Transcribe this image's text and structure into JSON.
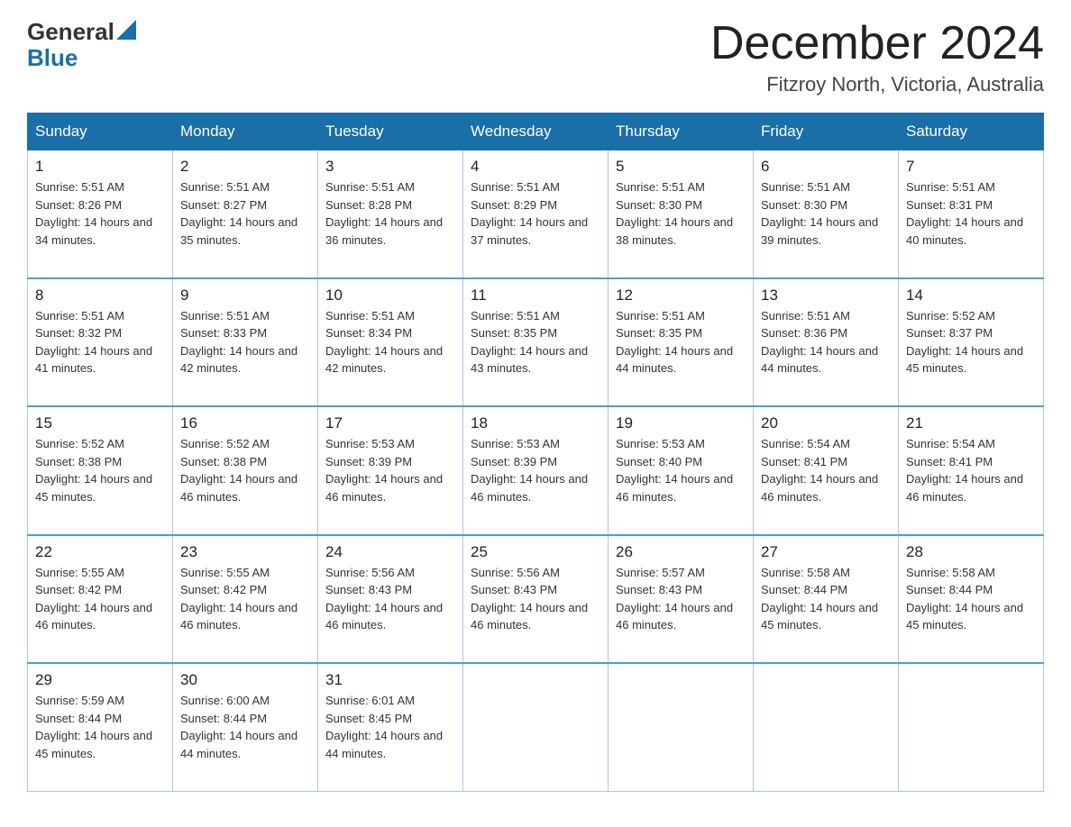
{
  "header": {
    "logo_general": "General",
    "logo_blue": "Blue",
    "month_title": "December 2024",
    "location": "Fitzroy North, Victoria, Australia"
  },
  "calendar": {
    "days_of_week": [
      "Sunday",
      "Monday",
      "Tuesday",
      "Wednesday",
      "Thursday",
      "Friday",
      "Saturday"
    ],
    "weeks": [
      [
        {
          "day": "1",
          "sunrise": "5:51 AM",
          "sunset": "8:26 PM",
          "daylight": "14 hours and 34 minutes."
        },
        {
          "day": "2",
          "sunrise": "5:51 AM",
          "sunset": "8:27 PM",
          "daylight": "14 hours and 35 minutes."
        },
        {
          "day": "3",
          "sunrise": "5:51 AM",
          "sunset": "8:28 PM",
          "daylight": "14 hours and 36 minutes."
        },
        {
          "day": "4",
          "sunrise": "5:51 AM",
          "sunset": "8:29 PM",
          "daylight": "14 hours and 37 minutes."
        },
        {
          "day": "5",
          "sunrise": "5:51 AM",
          "sunset": "8:30 PM",
          "daylight": "14 hours and 38 minutes."
        },
        {
          "day": "6",
          "sunrise": "5:51 AM",
          "sunset": "8:30 PM",
          "daylight": "14 hours and 39 minutes."
        },
        {
          "day": "7",
          "sunrise": "5:51 AM",
          "sunset": "8:31 PM",
          "daylight": "14 hours and 40 minutes."
        }
      ],
      [
        {
          "day": "8",
          "sunrise": "5:51 AM",
          "sunset": "8:32 PM",
          "daylight": "14 hours and 41 minutes."
        },
        {
          "day": "9",
          "sunrise": "5:51 AM",
          "sunset": "8:33 PM",
          "daylight": "14 hours and 42 minutes."
        },
        {
          "day": "10",
          "sunrise": "5:51 AM",
          "sunset": "8:34 PM",
          "daylight": "14 hours and 42 minutes."
        },
        {
          "day": "11",
          "sunrise": "5:51 AM",
          "sunset": "8:35 PM",
          "daylight": "14 hours and 43 minutes."
        },
        {
          "day": "12",
          "sunrise": "5:51 AM",
          "sunset": "8:35 PM",
          "daylight": "14 hours and 44 minutes."
        },
        {
          "day": "13",
          "sunrise": "5:51 AM",
          "sunset": "8:36 PM",
          "daylight": "14 hours and 44 minutes."
        },
        {
          "day": "14",
          "sunrise": "5:52 AM",
          "sunset": "8:37 PM",
          "daylight": "14 hours and 45 minutes."
        }
      ],
      [
        {
          "day": "15",
          "sunrise": "5:52 AM",
          "sunset": "8:38 PM",
          "daylight": "14 hours and 45 minutes."
        },
        {
          "day": "16",
          "sunrise": "5:52 AM",
          "sunset": "8:38 PM",
          "daylight": "14 hours and 46 minutes."
        },
        {
          "day": "17",
          "sunrise": "5:53 AM",
          "sunset": "8:39 PM",
          "daylight": "14 hours and 46 minutes."
        },
        {
          "day": "18",
          "sunrise": "5:53 AM",
          "sunset": "8:39 PM",
          "daylight": "14 hours and 46 minutes."
        },
        {
          "day": "19",
          "sunrise": "5:53 AM",
          "sunset": "8:40 PM",
          "daylight": "14 hours and 46 minutes."
        },
        {
          "day": "20",
          "sunrise": "5:54 AM",
          "sunset": "8:41 PM",
          "daylight": "14 hours and 46 minutes."
        },
        {
          "day": "21",
          "sunrise": "5:54 AM",
          "sunset": "8:41 PM",
          "daylight": "14 hours and 46 minutes."
        }
      ],
      [
        {
          "day": "22",
          "sunrise": "5:55 AM",
          "sunset": "8:42 PM",
          "daylight": "14 hours and 46 minutes."
        },
        {
          "day": "23",
          "sunrise": "5:55 AM",
          "sunset": "8:42 PM",
          "daylight": "14 hours and 46 minutes."
        },
        {
          "day": "24",
          "sunrise": "5:56 AM",
          "sunset": "8:43 PM",
          "daylight": "14 hours and 46 minutes."
        },
        {
          "day": "25",
          "sunrise": "5:56 AM",
          "sunset": "8:43 PM",
          "daylight": "14 hours and 46 minutes."
        },
        {
          "day": "26",
          "sunrise": "5:57 AM",
          "sunset": "8:43 PM",
          "daylight": "14 hours and 46 minutes."
        },
        {
          "day": "27",
          "sunrise": "5:58 AM",
          "sunset": "8:44 PM",
          "daylight": "14 hours and 45 minutes."
        },
        {
          "day": "28",
          "sunrise": "5:58 AM",
          "sunset": "8:44 PM",
          "daylight": "14 hours and 45 minutes."
        }
      ],
      [
        {
          "day": "29",
          "sunrise": "5:59 AM",
          "sunset": "8:44 PM",
          "daylight": "14 hours and 45 minutes."
        },
        {
          "day": "30",
          "sunrise": "6:00 AM",
          "sunset": "8:44 PM",
          "daylight": "14 hours and 44 minutes."
        },
        {
          "day": "31",
          "sunrise": "6:01 AM",
          "sunset": "8:45 PM",
          "daylight": "14 hours and 44 minutes."
        },
        null,
        null,
        null,
        null
      ]
    ]
  }
}
